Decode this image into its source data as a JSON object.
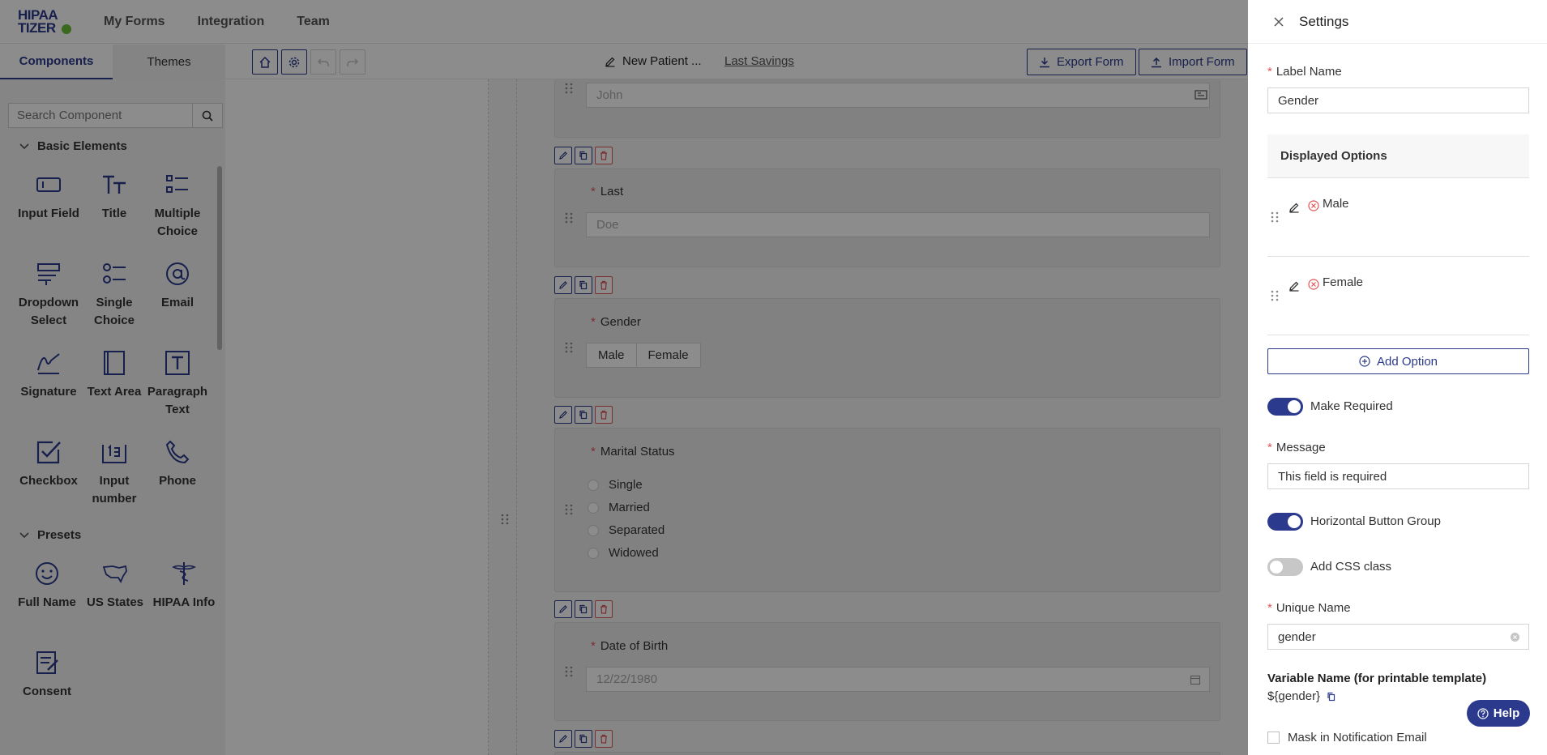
{
  "nav": {
    "logo_line1": "HIPAA",
    "logo_line2": "TIZER",
    "links": [
      "My Forms",
      "Integration",
      "Team"
    ]
  },
  "left": {
    "tabs": [
      "Components",
      "Themes"
    ],
    "search_placeholder": "Search Component",
    "basic_section": "Basic Elements",
    "presets_section": "Presets",
    "components": [
      {
        "label": "Input Field",
        "icon": "input-field-icon"
      },
      {
        "label": "Title",
        "icon": "title-icon"
      },
      {
        "label": "Multiple Choice",
        "icon": "multiple-choice-icon"
      },
      {
        "label": "Dropdown Select",
        "icon": "dropdown-select-icon"
      },
      {
        "label": "Single Choice",
        "icon": "single-choice-icon"
      },
      {
        "label": "Email",
        "icon": "email-icon"
      },
      {
        "label": "Signature",
        "icon": "signature-icon"
      },
      {
        "label": "Text Area",
        "icon": "text-area-icon"
      },
      {
        "label": "Paragraph Text",
        "icon": "paragraph-text-icon"
      },
      {
        "label": "Checkbox",
        "icon": "checkbox-icon"
      },
      {
        "label": "Input number",
        "icon": "input-number-icon"
      },
      {
        "label": "Phone",
        "icon": "phone-icon"
      }
    ],
    "presets": [
      {
        "label": "Full Name",
        "icon": "smiley-icon"
      },
      {
        "label": "US States",
        "icon": "us-map-icon"
      },
      {
        "label": "HIPAA Info",
        "icon": "caduceus-icon"
      },
      {
        "label": "Consent",
        "icon": "consent-icon"
      }
    ]
  },
  "toolbar": {
    "form_name": "New Patient ...",
    "last_savings": "Last Savings",
    "export_label": "Export Form",
    "import_label": "Import Form"
  },
  "canvas": {
    "first_placeholder": "John",
    "last_label": "Last",
    "last_placeholder": "Doe",
    "gender_label": "Gender",
    "gender_options": [
      "Male",
      "Female"
    ],
    "marital_label": "Marital Status",
    "marital_options": [
      "Single",
      "Married",
      "Separated",
      "Widowed"
    ],
    "dob_label": "Date of Birth",
    "dob_placeholder": "12/22/1980"
  },
  "settings": {
    "title": "Settings",
    "label_name_label": "Label Name",
    "label_name_value": "Gender",
    "displayed_options_label": "Displayed Options",
    "options": [
      "Male",
      "Female"
    ],
    "add_option_label": "Add Option",
    "make_required_label": "Make Required",
    "make_required_on": true,
    "message_label": "Message",
    "message_value": "This field is required",
    "horizontal_label": "Horizontal Button Group",
    "horizontal_on": true,
    "css_label": "Add CSS class",
    "css_on": false,
    "unique_name_label": "Unique Name",
    "unique_name_value": "gender",
    "variable_name_label": "Variable Name (for printable template)",
    "variable_name_value": "${gender}",
    "help_label": "Help",
    "mask_label": "Mask in Notification Email"
  },
  "colors": {
    "brand": "#2b3a8c",
    "required": "#e05555",
    "logo_green": "#6abf3a"
  }
}
